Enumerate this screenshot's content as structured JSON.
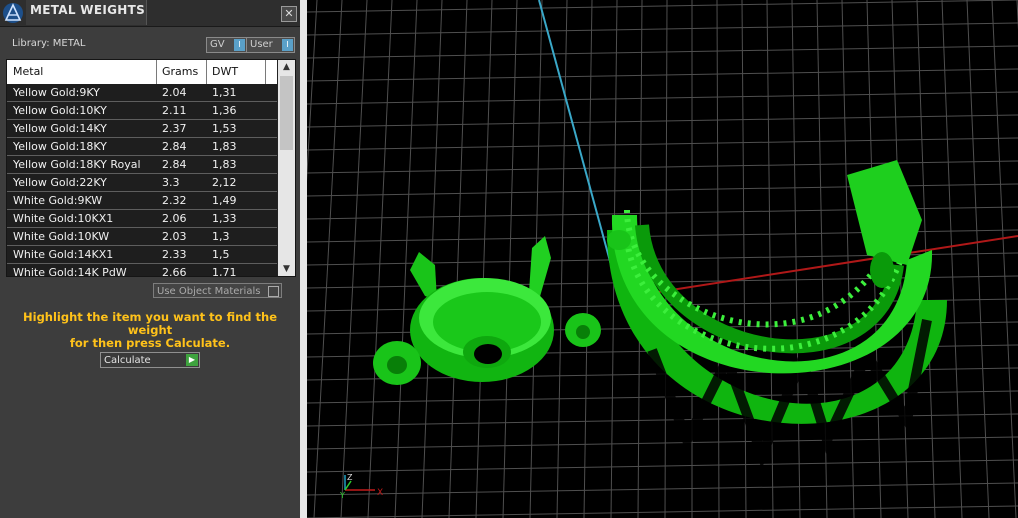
{
  "panel": {
    "title": "METAL WEIGHTS",
    "close_glyph": "✕",
    "library_label": "Library: METAL",
    "gv_label": "GV",
    "user_label": "User",
    "toggle_glyph": "I",
    "columns": [
      "Metal",
      "Grams",
      "DWT"
    ],
    "rows": [
      {
        "metal": "Yellow Gold:9KY",
        "grams": "2.04",
        "dwt": "1,31"
      },
      {
        "metal": "Yellow Gold:10KY",
        "grams": "2.11",
        "dwt": "1,36"
      },
      {
        "metal": "Yellow Gold:14KY",
        "grams": "2.37",
        "dwt": "1,53"
      },
      {
        "metal": "Yellow Gold:18KY",
        "grams": "2.84",
        "dwt": "1,83"
      },
      {
        "metal": "Yellow Gold:18KY Royal",
        "grams": "2.84",
        "dwt": "1,83"
      },
      {
        "metal": "Yellow Gold:22KY",
        "grams": "3.3",
        "dwt": "2,12"
      },
      {
        "metal": "White Gold:9KW",
        "grams": "2.32",
        "dwt": "1,49"
      },
      {
        "metal": "White Gold:10KX1",
        "grams": "2.06",
        "dwt": "1,33"
      },
      {
        "metal": "White Gold:10KW",
        "grams": "2.03",
        "dwt": "1,3"
      },
      {
        "metal": "White Gold:14KX1",
        "grams": "2.33",
        "dwt": "1,5"
      },
      {
        "metal": "White Gold:14K PdW",
        "grams": "2.66",
        "dwt": "1,71"
      }
    ],
    "scroll_up": "▲",
    "scroll_down": "▼",
    "use_object_materials": "Use Object Materials",
    "hint_line1": "Highlight the item you want to find the weight",
    "hint_line2": "for then press Calculate.",
    "calculate_label": "Calculate",
    "calculate_arrow": "▶"
  },
  "viewport": {
    "axis_x_label": "X",
    "axis_y_label": "Y",
    "axis_z_label": "Z",
    "model_color": "#00dd00",
    "grid_color": "#555555",
    "background": "#000000"
  }
}
